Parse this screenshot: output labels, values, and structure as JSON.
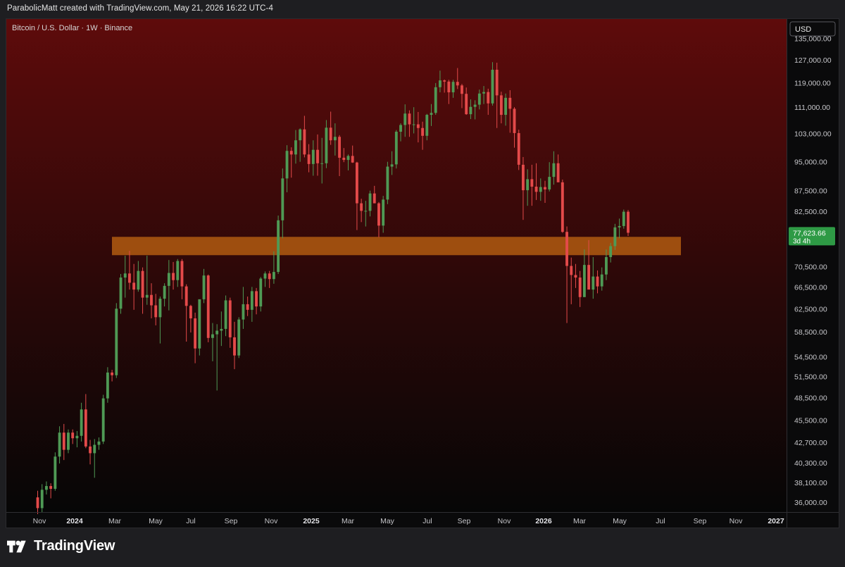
{
  "header": {
    "attribution": "ParabolicMatt created with TradingView.com, May 21, 2026 16:22 UTC-4"
  },
  "branding": {
    "name": "TradingView"
  },
  "colors": {
    "up": "#4f9a55",
    "down": "#e44a4a",
    "zone": "#c86a12",
    "last_price_bg": "#2e9a45",
    "gradient_top": "#5e0b0b",
    "gradient_bottom": "#060606"
  },
  "chart_data": {
    "type": "candlestick",
    "title": "Bitcoin / U.S. Dollar · 1W · Binance",
    "currency": "USD",
    "y_scale": "log",
    "ylim": [
      35500,
      141000
    ],
    "x_ticks": [
      "Nov",
      "2024",
      "Mar",
      "May",
      "Jul",
      "Sep",
      "Nov",
      "2025",
      "Mar",
      "May",
      "Jul",
      "Sep",
      "Nov",
      "2026",
      "Mar",
      "May",
      "Jul",
      "Sep",
      "Nov",
      "2027"
    ],
    "y_ticks": [
      {
        "value": 135000,
        "label": "135,000.00"
      },
      {
        "value": 127000,
        "label": "127,000.00"
      },
      {
        "value": 119000,
        "label": "119,000.00"
      },
      {
        "value": 111000,
        "label": "111,000.00"
      },
      {
        "value": 103000,
        "label": "103,000.00"
      },
      {
        "value": 95000,
        "label": "95,000.00"
      },
      {
        "value": 87500,
        "label": "87,500.00"
      },
      {
        "value": 82500,
        "label": "82,500.00"
      },
      {
        "value": 70500,
        "label": "70,500.00"
      },
      {
        "value": 66500,
        "label": "66,500.00"
      },
      {
        "value": 62500,
        "label": "62,500.00"
      },
      {
        "value": 58500,
        "label": "58,500.00"
      },
      {
        "value": 54500,
        "label": "54,500.00"
      },
      {
        "value": 51500,
        "label": "51,500.00"
      },
      {
        "value": 48500,
        "label": "48,500.00"
      },
      {
        "value": 45500,
        "label": "45,500.00"
      },
      {
        "value": 42700,
        "label": "42,700.00"
      },
      {
        "value": 40300,
        "label": "40,300.00"
      },
      {
        "value": 38100,
        "label": "38,100.00"
      },
      {
        "value": 36000,
        "label": "36,000.00"
      }
    ],
    "last_price": {
      "value": 77623.66,
      "label": "77,623.66",
      "countdown": "3d 4h"
    },
    "support_zone": {
      "low": 72800,
      "high": 76700
    },
    "ohlc": [
      [
        36500,
        37200,
        34800,
        35400
      ],
      [
        35400,
        37900,
        35000,
        37300
      ],
      [
        37300,
        38200,
        36800,
        37700
      ],
      [
        37700,
        38000,
        36400,
        37400
      ],
      [
        37400,
        41500,
        37200,
        41000
      ],
      [
        41000,
        44700,
        40200,
        43900
      ],
      [
        43900,
        45000,
        40600,
        41800
      ],
      [
        41800,
        44300,
        41400,
        43900
      ],
      [
        43900,
        44300,
        42500,
        43200
      ],
      [
        43200,
        44100,
        42100,
        43500
      ],
      [
        43500,
        47800,
        42800,
        46900
      ],
      [
        46900,
        49000,
        42000,
        42200
      ],
      [
        42200,
        43000,
        40100,
        41400
      ],
      [
        41400,
        43100,
        38600,
        42400
      ],
      [
        42400,
        43300,
        41800,
        42800
      ],
      [
        42800,
        48900,
        42500,
        48400
      ],
      [
        48400,
        52900,
        47800,
        52100
      ],
      [
        52100,
        52500,
        50800,
        51700
      ],
      [
        51700,
        63500,
        51300,
        62500
      ],
      [
        62500,
        69000,
        61600,
        68300
      ],
      [
        68300,
        72700,
        64500,
        69100
      ],
      [
        69100,
        73700,
        66000,
        67300
      ],
      [
        67300,
        71000,
        62300,
        66000
      ],
      [
        66000,
        71600,
        65600,
        69600
      ],
      [
        69600,
        70300,
        61600,
        64500
      ],
      [
        64500,
        72700,
        63200,
        65000
      ],
      [
        65000,
        67200,
        60800,
        63100
      ],
      [
        63100,
        65200,
        59600,
        61000
      ],
      [
        61000,
        64700,
        56600,
        64300
      ],
      [
        64300,
        67200,
        62900,
        66700
      ],
      [
        66700,
        71800,
        62200,
        69200
      ],
      [
        69200,
        71400,
        66000,
        67800
      ],
      [
        67800,
        72000,
        66500,
        71600
      ],
      [
        71600,
        72000,
        64200,
        66600
      ],
      [
        66600,
        67000,
        56900,
        63000
      ],
      [
        63000,
        63200,
        58400,
        60800
      ],
      [
        60800,
        61800,
        53500,
        55800
      ],
      [
        55800,
        64000,
        54700,
        64200
      ],
      [
        64200,
        70000,
        63500,
        68700
      ],
      [
        68700,
        68900,
        56800,
        57500
      ],
      [
        57500,
        60000,
        53800,
        58100
      ],
      [
        58100,
        59800,
        49500,
        58700
      ],
      [
        58700,
        62000,
        56200,
        59000
      ],
      [
        59000,
        64900,
        57800,
        64000
      ],
      [
        64000,
        64500,
        55900,
        57600
      ],
      [
        57600,
        60200,
        52600,
        54700
      ],
      [
        54700,
        61000,
        54300,
        60600
      ],
      [
        60600,
        66500,
        59000,
        63300
      ],
      [
        63300,
        64700,
        61200,
        62300
      ],
      [
        62300,
        66500,
        60200,
        65700
      ],
      [
        65700,
        66300,
        61500,
        62900
      ],
      [
        62900,
        68400,
        62000,
        68100
      ],
      [
        68100,
        69500,
        66500,
        69100
      ],
      [
        69100,
        69600,
        66300,
        68000
      ],
      [
        68000,
        73600,
        67100,
        69400
      ],
      [
        69400,
        81500,
        69000,
        80400
      ],
      [
        80400,
        93200,
        76400,
        90600
      ],
      [
        90600,
        99600,
        87100,
        98000
      ],
      [
        98000,
        99000,
        90800,
        97000
      ],
      [
        97000,
        104000,
        94500,
        101000
      ],
      [
        101000,
        104500,
        95000,
        104200
      ],
      [
        104200,
        108300,
        96200,
        97000
      ],
      [
        97000,
        99900,
        92200,
        94400
      ],
      [
        94400,
        101000,
        91300,
        98300
      ],
      [
        98300,
        102700,
        91300,
        94600
      ],
      [
        94600,
        101700,
        89300,
        94600
      ],
      [
        94600,
        107000,
        93300,
        104700
      ],
      [
        104700,
        109600,
        99700,
        101000
      ],
      [
        101000,
        106000,
        96700,
        102000
      ],
      [
        102000,
        102500,
        91200,
        96100
      ],
      [
        96100,
        98800,
        94900,
        95500
      ],
      [
        95500,
        97000,
        92700,
        96600
      ],
      [
        96600,
        99500,
        94700,
        94800
      ],
      [
        94800,
        95000,
        78200,
        84400
      ],
      [
        84400,
        85500,
        80000,
        82600
      ],
      [
        82600,
        85000,
        79000,
        82600
      ],
      [
        82600,
        87500,
        81300,
        86800
      ],
      [
        86800,
        88700,
        84400,
        84400
      ],
      [
        84400,
        84700,
        76600,
        79200
      ],
      [
        79200,
        86200,
        77600,
        85300
      ],
      [
        85300,
        95000,
        84200,
        93700
      ],
      [
        93700,
        97900,
        91500,
        94300
      ],
      [
        94300,
        104000,
        93200,
        103500
      ],
      [
        103500,
        106000,
        100700,
        105500
      ],
      [
        105500,
        111900,
        102000,
        109000
      ],
      [
        109000,
        110000,
        102000,
        105700
      ],
      [
        105700,
        111000,
        103000,
        105700
      ],
      [
        105700,
        109500,
        100400,
        104600
      ],
      [
        104600,
        106500,
        98300,
        102300
      ],
      [
        102300,
        108900,
        101000,
        108600
      ],
      [
        108600,
        112000,
        105200,
        109200
      ],
      [
        109200,
        118900,
        108600,
        117500
      ],
      [
        117500,
        123200,
        115800,
        119800
      ],
      [
        119800,
        120100,
        115700,
        119400
      ],
      [
        119400,
        120000,
        112000,
        115800
      ],
      [
        115800,
        120000,
        114000,
        119300
      ],
      [
        119300,
        124100,
        116900,
        118100
      ],
      [
        118100,
        118600,
        110700,
        115300
      ],
      [
        115300,
        117400,
        108600,
        108800
      ],
      [
        108800,
        113500,
        107300,
        111100
      ],
      [
        111100,
        113200,
        107200,
        111800
      ],
      [
        111800,
        116700,
        110300,
        115400
      ],
      [
        115400,
        117900,
        112000,
        115900
      ],
      [
        115900,
        117000,
        108600,
        112200
      ],
      [
        112200,
        126200,
        111500,
        123500
      ],
      [
        123500,
        126000,
        104600,
        114800
      ],
      [
        114800,
        116000,
        106000,
        108600
      ],
      [
        108600,
        115400,
        105300,
        114000
      ],
      [
        114000,
        116500,
        103200,
        110500
      ],
      [
        110500,
        111000,
        98900,
        103100
      ],
      [
        103100,
        104100,
        92800,
        94200
      ],
      [
        94200,
        96300,
        80500,
        87600
      ],
      [
        87600,
        93000,
        83800,
        90400
      ],
      [
        90400,
        94200,
        83800,
        88500
      ],
      [
        88500,
        94600,
        85200,
        87200
      ],
      [
        87200,
        90600,
        85000,
        88400
      ],
      [
        88400,
        90000,
        84500,
        87800
      ],
      [
        87800,
        94900,
        87300,
        91000
      ],
      [
        91000,
        97900,
        89000,
        94600
      ],
      [
        94600,
        97000,
        92000,
        89600
      ],
      [
        89600,
        90300,
        77600,
        77800
      ],
      [
        77800,
        79000,
        60000,
        70600
      ],
      [
        70600,
        72300,
        63300,
        68800
      ],
      [
        68800,
        71000,
        66300,
        68300
      ],
      [
        68300,
        69600,
        62800,
        64600
      ],
      [
        64600,
        74000,
        64600,
        70800
      ],
      [
        70800,
        76000,
        66200,
        66000
      ],
      [
        66000,
        72400,
        64300,
        68500
      ],
      [
        68500,
        69700,
        65300,
        66600
      ],
      [
        66600,
        70300,
        65800,
        68900
      ],
      [
        68900,
        74000,
        67800,
        72400
      ],
      [
        72400,
        75400,
        71300,
        74700
      ],
      [
        74700,
        79600,
        73900,
        78800
      ],
      [
        78800,
        80800,
        76400,
        79100
      ],
      [
        79100,
        82900,
        78500,
        82400
      ],
      [
        82400,
        82800,
        76900,
        77600
      ]
    ]
  }
}
